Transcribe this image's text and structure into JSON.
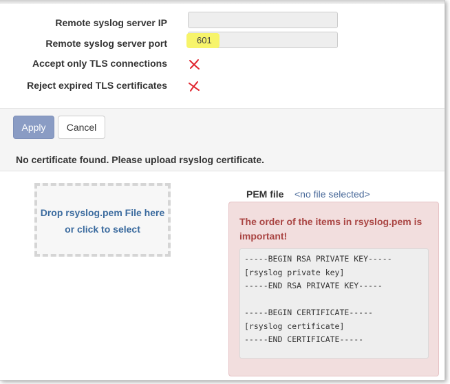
{
  "settings": {
    "remote_ip_label": "Remote syslog server IP",
    "remote_ip_value": "",
    "remote_port_label": "Remote syslog server port",
    "remote_port_value": "601",
    "tls_only_label": "Accept only TLS connections",
    "reject_expired_label": "Reject expired TLS certificates"
  },
  "buttons": {
    "apply": "Apply",
    "cancel": "Cancel"
  },
  "notice": "No certificate found. Please upload rsyslog certificate.",
  "dropzone": {
    "line1": "Drop rsyslog.pem File here",
    "line2": "or click to select"
  },
  "pem": {
    "label": "PEM file",
    "value": "<no file selected>"
  },
  "warning": {
    "title": "The order of the items in rsyslog.pem is important!",
    "code": "-----BEGIN RSA PRIVATE KEY-----\n[rsyslog private key]\n-----END RSA PRIVATE KEY-----\n\n-----BEGIN CERTIFICATE-----\n[rsyslog certificate]\n-----END CERTIFICATE-----"
  },
  "colors": {
    "apply_bg": "#8a9cc4",
    "warning_bg": "#f2dede",
    "warning_text": "#a94442",
    "link_text": "#3a6a9e",
    "cross_icon": "#e0242e",
    "highlight": "#f7f46a"
  },
  "icons": [
    "cross-icon"
  ]
}
